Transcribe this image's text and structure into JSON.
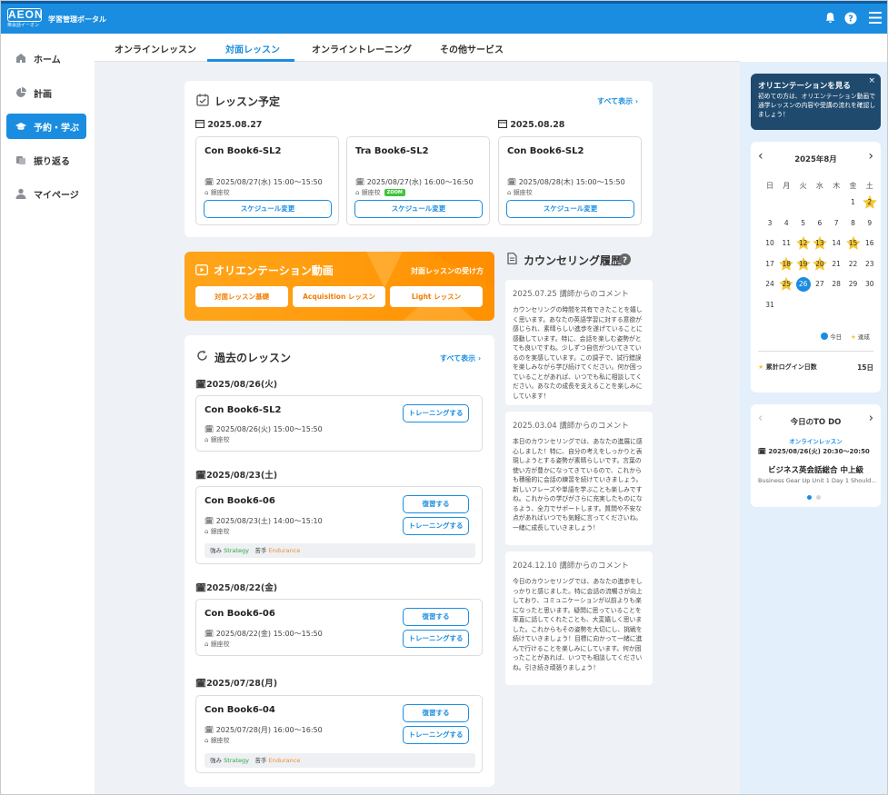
{
  "header": {
    "logo": "AEON",
    "logo_sub": "英会話イーオン",
    "portal_title": "学習管理ポータル"
  },
  "sidebar": {
    "items": [
      {
        "label": "ホーム",
        "icon": "home-icon",
        "active": false
      },
      {
        "label": "計画",
        "icon": "pie-chart-icon",
        "active": false
      },
      {
        "label": "予約・学ぶ",
        "icon": "graduation-cap-icon",
        "active": true
      },
      {
        "label": "振り返る",
        "icon": "review-icon",
        "active": false
      },
      {
        "label": "マイページ",
        "icon": "user-icon",
        "active": false
      }
    ]
  },
  "tabs": [
    {
      "label": "オンラインレッスン",
      "active": false
    },
    {
      "label": "対面レッスン",
      "active": true
    },
    {
      "label": "オンライントレーニング",
      "active": false
    },
    {
      "label": "その他サービス",
      "active": false
    }
  ],
  "schedule": {
    "title": "レッスン予定",
    "see_all": "すべて表示",
    "dates": [
      "2025.08.27",
      "2025.08.28"
    ],
    "lessons": [
      {
        "title": "Con Book6-SL2",
        "time": "2025/08/27(水) 15:00～15:50",
        "location": "銀座校",
        "zoom": "",
        "button": "スケジュール変更"
      },
      {
        "title": "Tra Book6-SL2",
        "time": "2025/08/27(水) 16:00～16:50",
        "location": "銀座校",
        "zoom": "ZOOM",
        "button": "スケジュール変更"
      },
      {
        "title": "Con Book6-SL2",
        "time": "2025/08/28(木) 15:00～15:50",
        "location": "銀座校",
        "zoom": "",
        "button": "スケジュール変更"
      }
    ]
  },
  "orientation": {
    "title": "オリエンテーション動画",
    "subtitle": "対面レッスンの受け方",
    "buttons": [
      "対面レッスン基礎",
      "Acquisition レッスン",
      "Light レッスン"
    ]
  },
  "past": {
    "title": "過去のレッスン",
    "see_all": "すべて表示",
    "groups": [
      {
        "date": "2025/08/26(火)",
        "title": "Con Book6-SL2",
        "time": "2025/08/26(火) 15:00～15:50",
        "location": "銀座校",
        "review": "",
        "training": "トレーニングする",
        "strength_label": "",
        "strength": "",
        "weak_label": "",
        "weak": ""
      },
      {
        "date": "2025/08/23(土)",
        "title": "Con Book6-06",
        "time": "2025/08/23(土) 14:00～15:10",
        "location": "銀座校",
        "review": "復習する",
        "training": "トレーニングする",
        "strength_label": "強み",
        "strength": "Strategy",
        "weak_label": "苦手",
        "weak": "Endurance"
      },
      {
        "date": "2025/08/22(金)",
        "title": "Con Book6-06",
        "time": "2025/08/22(金) 15:00～15:50",
        "location": "銀座校",
        "review": "復習する",
        "training": "トレーニングする",
        "strength_label": "",
        "strength": "",
        "weak_label": "",
        "weak": ""
      },
      {
        "date": "2025/07/28(月)",
        "title": "Con Book6-04",
        "time": "2025/07/28(月) 16:00～16:50",
        "location": "銀座校",
        "review": "復習する",
        "training": "トレーニングする",
        "strength_label": "強み",
        "strength": "Strategy",
        "weak_label": "苦手",
        "weak": "Endurance"
      }
    ]
  },
  "counseling": {
    "title": "カウンセリング履歴",
    "items": [
      {
        "date": "2025.07.25",
        "label": "講師からのコメント",
        "text": "カウンセリングの時間を共有できたことを嬉しく思います。あなたの英語学習に対する意欲が感じられ、素晴らしい進歩を遂げていることに感動しています。特に、会話を楽しむ姿勢がとても良いですね。少しずつ自信がついてきているのを実感しています。この調子で、試行錯誤を楽しみながら学び続けてください。何か困っていることがあれば、いつでも私に相談してください。あなたの成長を支えることを楽しみにしています！"
      },
      {
        "date": "2025.03.04",
        "label": "講師からのコメント",
        "text": "本日のカウンセリングでは、あなたの進展に感心しました！特に、自分の考えをしっかりと表現しようとする姿勢が素晴らしいです。言葉の使い方が豊かになってきているので、これからも積極的に会話の練習を続けていきましょう。新しいフレーズや単語を学ぶことも楽しみですね。これからの学びがさらに充実したものになるよう、全力でサポートします。質問や不安な点があればいつでも気軽に言ってくださいね。一緒に成長していきましょう！"
      },
      {
        "date": "2024.12.10",
        "label": "講師からのコメント",
        "text": "今日のカウンセリングでは、あなたの進歩をしっかりと感じました。特に会話の流暢さが向上しており、コミュニケーションが以前よりも楽になったと思います。疑問に思っていることを率直に話してくれたことも、大変嬉しく思いました。これからもその姿勢を大切にし、挑戦を続けていきましょう！目標に向かって一緒に進んで行けることを楽しみにしています。何か困ったことがあれば、いつでも相談してくださいね。引き続き頑張りましょう！"
      }
    ]
  },
  "promo": {
    "title": "オリエンテーションを見る",
    "text": "初めての方は、オリエンテーション動画で通学レッスンの内容や受講の流れを確認しましょう！",
    "close": "×"
  },
  "calendar": {
    "month": "2025年8月",
    "prev": "‹",
    "next": "›",
    "weekdays": [
      "日",
      "月",
      "火",
      "水",
      "木",
      "金",
      "土"
    ],
    "first_weekday": 5,
    "days": 31,
    "today": 26,
    "star_days": [
      2,
      12,
      13,
      15,
      18,
      19,
      20,
      25
    ],
    "legend_today": "今日",
    "legend_done": "達成",
    "login_label": "累計ログイン日数",
    "login_value": "15日"
  },
  "todo": {
    "title": "今日のTO DO",
    "category": "オンラインレッスン",
    "time": "2025/08/26(火) 20:30～20:50",
    "course": "ビジネス英会話総合 中上級",
    "detail": "Business Gear Up Unit 1 Day 1 Should…"
  },
  "colors": {
    "primary": "#1a8de0",
    "accent": "#ff9f1a",
    "star": "#f7c62f"
  }
}
